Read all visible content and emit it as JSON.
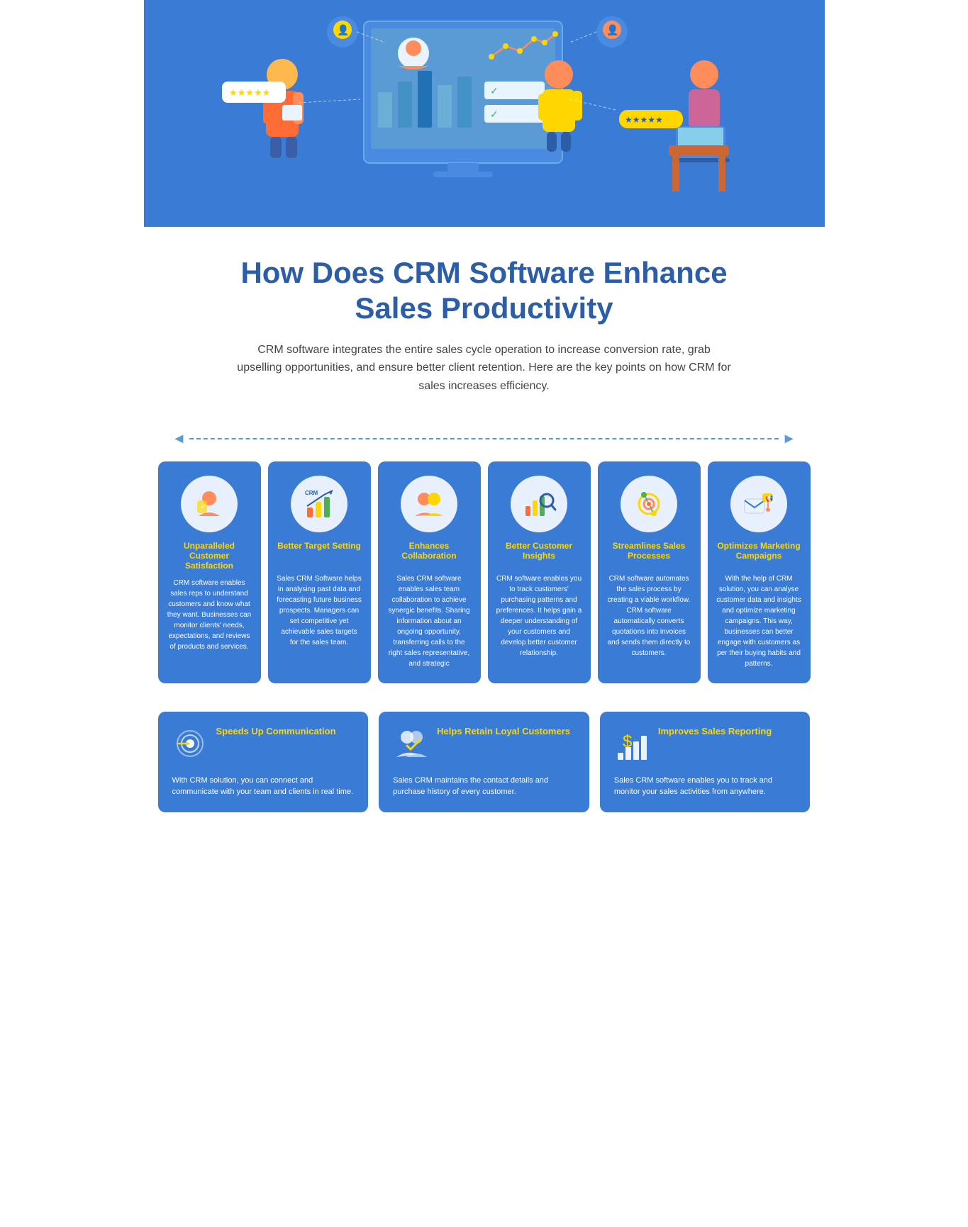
{
  "hero": {
    "bg_color": "#3a7bd5"
  },
  "title": "How Does CRM Software Enhance Sales Productivity",
  "subtitle": "CRM software integrates the entire sales cycle operation to increase conversion rate, grab upselling opportunities, and ensure better client retention. Here are the key points on how CRM for sales increases efficiency.",
  "cards_top": [
    {
      "id": "card-1",
      "title": "Unparalleled Customer Satisfaction",
      "text": "CRM software enables sales reps to understand customers and know what they want. Businesses can monitor clients' needs, expectations, and reviews of products and services.",
      "icon": "👤",
      "icon_color": "#f5a623"
    },
    {
      "id": "card-2",
      "title": "Better Target Setting",
      "text": "Sales CRM Software helps in analysing past data and forecasting future business prospects. Managers can set competitive yet achievable sales targets for the sales team.",
      "icon": "📊",
      "icon_color": "#f5a623"
    },
    {
      "id": "card-3",
      "title": "Enhances Collaboration",
      "text": "Sales CRM software enables sales team collaboration to achieve synergic benefits. Sharing information about an ongoing opportunity, transferring calls to the right sales representative, and strategic",
      "icon": "🤝",
      "icon_color": "#f5a623"
    },
    {
      "id": "card-4",
      "title": "Better Customer Insights",
      "text": "CRM software enables you to track customers' purchasing patterns and preferences. It helps gain a deeper understanding of your customers and develop better customer relationship.",
      "icon": "🔍",
      "icon_color": "#f5a623"
    },
    {
      "id": "card-5",
      "title": "Streamlines Sales Processes",
      "text": "CRM software automates the sales process by creating a viable workflow. CRM software automatically converts quotations into invoices and sends them directly to customers.",
      "icon": "⚙️",
      "icon_color": "#f5a623"
    },
    {
      "id": "card-6",
      "title": "Optimizes Marketing Campaigns",
      "text": "With the help of CRM solution, you can analyse customer data and insights and optimize marketing campaigns. This way, businesses can better engage with customers as per their buying habits and patterns.",
      "icon": "📢",
      "icon_color": "#f5a623"
    }
  ],
  "cards_bottom": [
    {
      "id": "card-b1",
      "title": "Speeds Up Communication",
      "text": "With CRM solution, you can connect and communicate with your team and clients in real time.",
      "icon": "🔄"
    },
    {
      "id": "card-b2",
      "title": "Helps Retain Loyal Customers",
      "text": "Sales CRM maintains the contact details and purchase history of every customer.",
      "icon": "👥"
    },
    {
      "id": "card-b3",
      "title": "Improves Sales Reporting",
      "text": "Sales CRM software enables you to track and monitor your sales activities from anywhere.",
      "icon": "💲"
    }
  ],
  "arrow": {
    "left": "◄",
    "right": "►"
  }
}
